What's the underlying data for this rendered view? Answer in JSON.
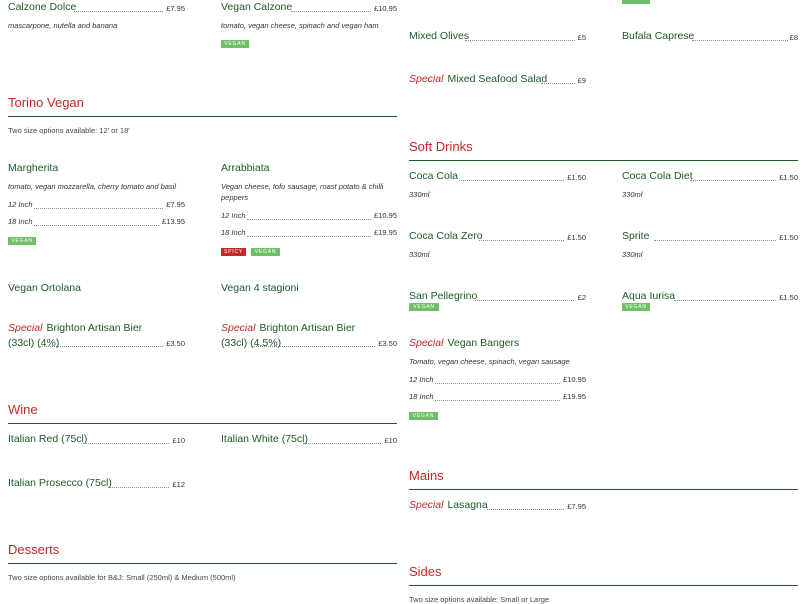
{
  "top": {
    "calzone_dolce": {
      "name": "Calzone Dolce",
      "price": "£7.95",
      "desc": "mascarpone, nutella and banana"
    },
    "vegan_calzone": {
      "name": "Vegan Calzone",
      "price": "£10.95",
      "desc": "tomato, vegan cheese, spinach and vegan ham",
      "badge": "VEGAN"
    },
    "mixed_olives": {
      "name": "Mixed Olives",
      "price": "£5"
    },
    "bufala_caprese": {
      "name": "Bufala Caprese",
      "price": "£8"
    },
    "mixed_seafood": {
      "special": "Special",
      "name": "Mixed Seafood Salad",
      "price": "£9"
    }
  },
  "torino_vegan": {
    "title": "Torino Vegan",
    "note": "Two size options available: 12' or 18'",
    "margherita": {
      "name": "Margherita",
      "desc": "tomato, vegan mozzarella, cherry tomato and basil",
      "size1": "12 Inch",
      "price1": "£7.95",
      "size2": "18 Inch",
      "price2": "£13.95",
      "badge": "VEGAN"
    },
    "arrabbiata": {
      "name": "Arrabbiata",
      "desc": "Vegan cheese, tofu sausage, roast potato & chilli peppers",
      "size1": "12 Inch",
      "price1": "£10.95",
      "size2": "18 Inch",
      "price2": "£19.95",
      "badge_spicy": "SPICY",
      "badge_vegan": "VEGAN"
    },
    "ortolana": {
      "name": "Vegan Ortolana"
    },
    "quattro_stagioni": {
      "name": "Vegan 4 stagioni"
    },
    "bier_33": {
      "special": "Special",
      "name": "Brighton Artisan Bier (33cl) (4%)",
      "price": "£3.50"
    },
    "bier_45": {
      "special": "Special",
      "name": "Brighton Artisan Bier (33cl) (4.5%)",
      "price": "£3.50"
    }
  },
  "soft_drinks": {
    "title": "Soft Drinks",
    "coca_cola": {
      "name": "Coca Cola",
      "price": "£1.50",
      "desc": "330ml"
    },
    "coca_cola_diet": {
      "name": "Coca Cola Diet",
      "price": "£1.50",
      "desc": "330ml"
    },
    "coca_cola_zero": {
      "name": "Coca Cola Zero",
      "price": "£1.50",
      "desc": "330ml"
    },
    "sprite": {
      "name": "Sprite",
      "price": "£1.50",
      "desc": "330ml"
    },
    "san_pellegrino": {
      "name": "San Pellegrino",
      "price": "£2",
      "badge": "VEGAN"
    },
    "aqua_iurisa": {
      "name": "Aqua Iurisa",
      "price": "£1.50",
      "badge": "VEGAN"
    },
    "vegan_bangers": {
      "special": "Special",
      "name": "Vegan Bangers",
      "desc": "Tomato, vegan cheese, spinach, vegan sausage",
      "size1": "12 Inch",
      "price1": "£10.95",
      "size2": "18 Inch",
      "price2": "£19.95",
      "badge": "VEGAN"
    }
  },
  "wine": {
    "title": "Wine",
    "italian_red": {
      "name": "Italian Red (75cl)",
      "price": "£10"
    },
    "italian_white": {
      "name": "Italian White (75cl)",
      "price": "£10"
    },
    "italian_prosecco": {
      "name": "Italian Prosecco (75cl)",
      "price": "£12"
    }
  },
  "mains": {
    "title": "Mains",
    "lasagna": {
      "special": "Special",
      "name": "Lasagna",
      "price": "£7.95"
    }
  },
  "desserts": {
    "title": "Desserts",
    "note": "Two size options available for B&J: Small (250ml) & Medium (500ml)"
  },
  "sides": {
    "title": "Sides",
    "note": "Two size options available: Small or Large"
  },
  "colors": {
    "heading_red": "#c62828",
    "item_green": "#1e5a2a",
    "vegan_badge": "#6fbf67",
    "spicy_badge": "#c62828"
  }
}
